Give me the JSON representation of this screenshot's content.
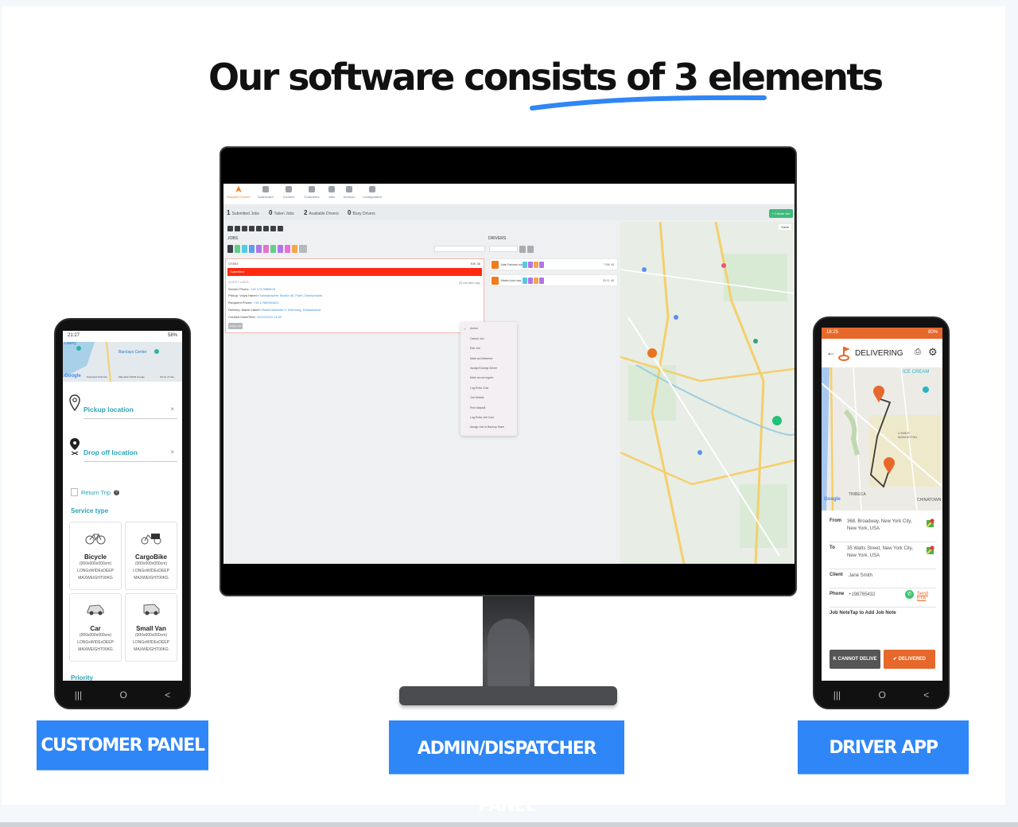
{
  "headline": "Our software consists of 3 elements",
  "colors": {
    "accent_blue": "#2f86f6",
    "driver_orange": "#e7682b",
    "customer_teal": "#29a3b8",
    "status_red": "#ff2a10",
    "create_green": "#3dbb7a"
  },
  "labels": {
    "customer": "CUSTOMER PANEL",
    "admin": "ADMIN/DISPATCHER PANEL",
    "driver": "DRIVER APP"
  },
  "admin": {
    "nav": [
      {
        "label": "Dispatch Screen",
        "icon": "dispatch-icon",
        "active": true
      },
      {
        "label": "Dashboard",
        "icon": "dashboard-icon"
      },
      {
        "label": "Couriers",
        "icon": "couriers-icon"
      },
      {
        "label": "Customers",
        "icon": "customers-icon"
      },
      {
        "label": "Jobs",
        "icon": "jobs-icon"
      },
      {
        "label": "Invoices",
        "icon": "invoice-icon"
      },
      {
        "label": "Configuration",
        "icon": "configuration-icon"
      }
    ],
    "stats": [
      {
        "value": "1",
        "label": "Submitted Jobs"
      },
      {
        "value": "0",
        "label": "Taken Jobs"
      },
      {
        "value": "2",
        "label": "Available Drivers"
      },
      {
        "value": "0",
        "label": "Busy Drivers"
      }
    ],
    "create_job": "+ Create Job",
    "jobs_heading": "JOBS",
    "drivers_heading": "DRIVERS",
    "job": {
      "id": "GS983",
      "time": "BIK 38",
      "status": "Submitted",
      "customer": "GUEST USER",
      "ago": "25 minutes ago",
      "sender_phone_label": "Sender Phone:",
      "sender_phone": "+49 173 3368678",
      "pickup_label": "Pickup: Volya Hanel",
      "pickup_address": "Schwabacher Straße 45, Fürth, Deutschland",
      "recipient_phone_label": "Recipient Phone:",
      "recipient_phone": "+49 17985903821",
      "delivery_label": "Delivery: Martin Hanel",
      "delivery_address": "Bahnhofstraße 5, Nürnberg, Deutschland",
      "created_label": "Created Date/Time:",
      "created": "29/10/2023 11:35",
      "action_button": "Assign Job"
    },
    "drivers": [
      {
        "name": "Aste Fahmad ma..",
        "count": "7",
        "dist": "BIK 48"
      },
      {
        "name": "Martin Auto max..",
        "count": "25",
        "dist": "CL 48"
      }
    ],
    "context_menu": [
      "Action",
      "Cancel Job",
      "Edit Job",
      "Mark as Delivered",
      "Assign/Change Driver",
      "Mark as not urgent",
      "Log Extra Cost",
      "Job Details",
      "Print Waybill",
      "Log Extra Job Cost",
      "Assign Job to Backup Team"
    ],
    "map_type": "Karte"
  },
  "customer": {
    "status_time": "21:27",
    "status_battery": "58%",
    "map_text": [
      "Liberty",
      "Barclays Center",
      "Keyboard shortcuts",
      "Map data ©2023 Google",
      "Terms of Use"
    ],
    "pickup_placeholder": "Pickup location",
    "dropoff_placeholder": "Drop off location",
    "return_trip": "Return Trip",
    "service_type": "Service type",
    "services": [
      {
        "name": "Bicycle",
        "dims": "(000x000x000cm)",
        "spec": "LONGxWIDExDEEP",
        "weight": "MAXWEIGHT00KG"
      },
      {
        "name": "CargoBike",
        "dims": "(000x000x000cm)",
        "spec": "LONGxWIDExDEEP",
        "weight": "MAXWEIGHT00KG"
      },
      {
        "name": "Car",
        "dims": "(000x000x000cm)",
        "spec": "LONGxWIDExDEEP",
        "weight": "MAXWEIGHT00KG"
      },
      {
        "name": "Small Van",
        "dims": "(000x000x000cm)",
        "spec": "LONGxWIDExDEEP",
        "weight": "MAXWEIGHT00KG"
      }
    ],
    "priority": "Priority"
  },
  "driver": {
    "status_time": "18:25",
    "status_battery": "80%",
    "title": "DELIVERING",
    "map_text": [
      "ICE CREAM",
      "LOWER MANHATTAN",
      "TRIBECA",
      "CHINATOWN"
    ],
    "from_label": "From",
    "from": "368, Broadway, New York City, New York, USA",
    "to_label": "To",
    "to": "35 Watts Street, New York City, New York, USA",
    "client_label": "Client",
    "client": "Jane Smith",
    "phone_label": "Phone",
    "phone": "+198765432",
    "send_eta": "Send ETA",
    "job_note": "Job NoteTap to Add Job Note",
    "cannot_deliver": "CANNOT DELIVE",
    "delivered": "DELIVERED"
  },
  "nav_buttons": [
    "|||",
    "O",
    "<"
  ]
}
